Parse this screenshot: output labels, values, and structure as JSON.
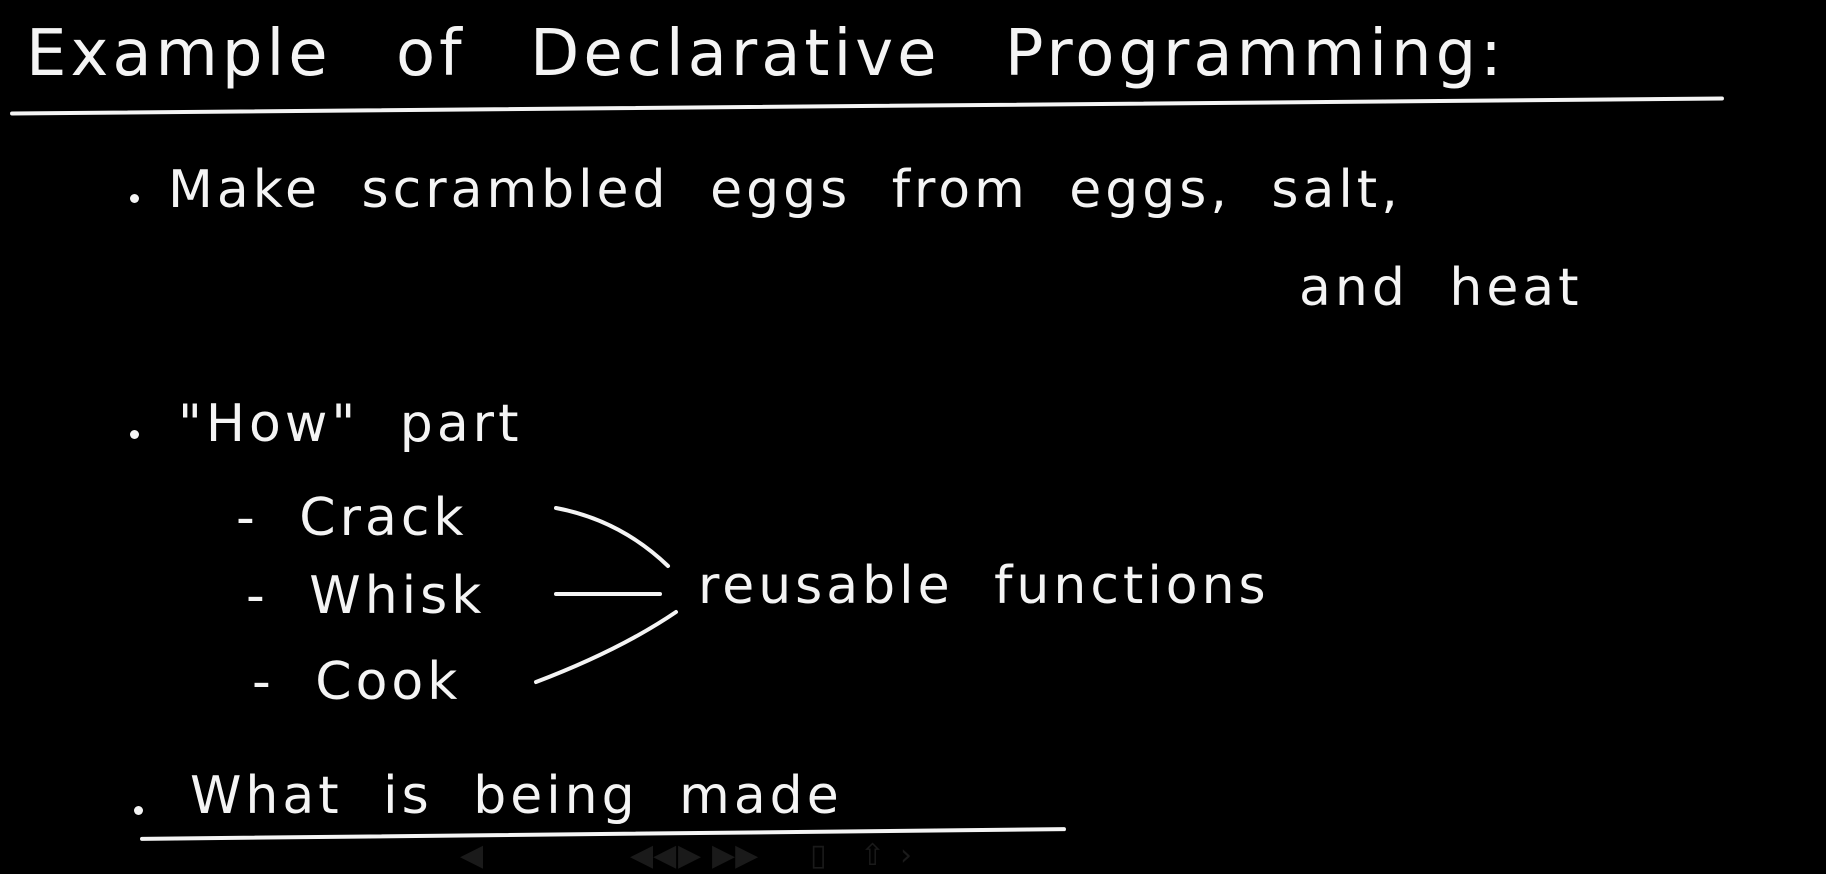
{
  "title": "Example of Declarative Programming:",
  "bullets": {
    "first_line1": "Make scrambled eggs from eggs, salt,",
    "first_line2": "and heat",
    "how": "\"How\" part",
    "steps": [
      "- Crack",
      "- Whisk",
      "- Cook"
    ],
    "reusable": "reusable functions",
    "what": "What is being made"
  },
  "colors": {
    "background": "#000000",
    "ink": "#f4f4f4"
  }
}
